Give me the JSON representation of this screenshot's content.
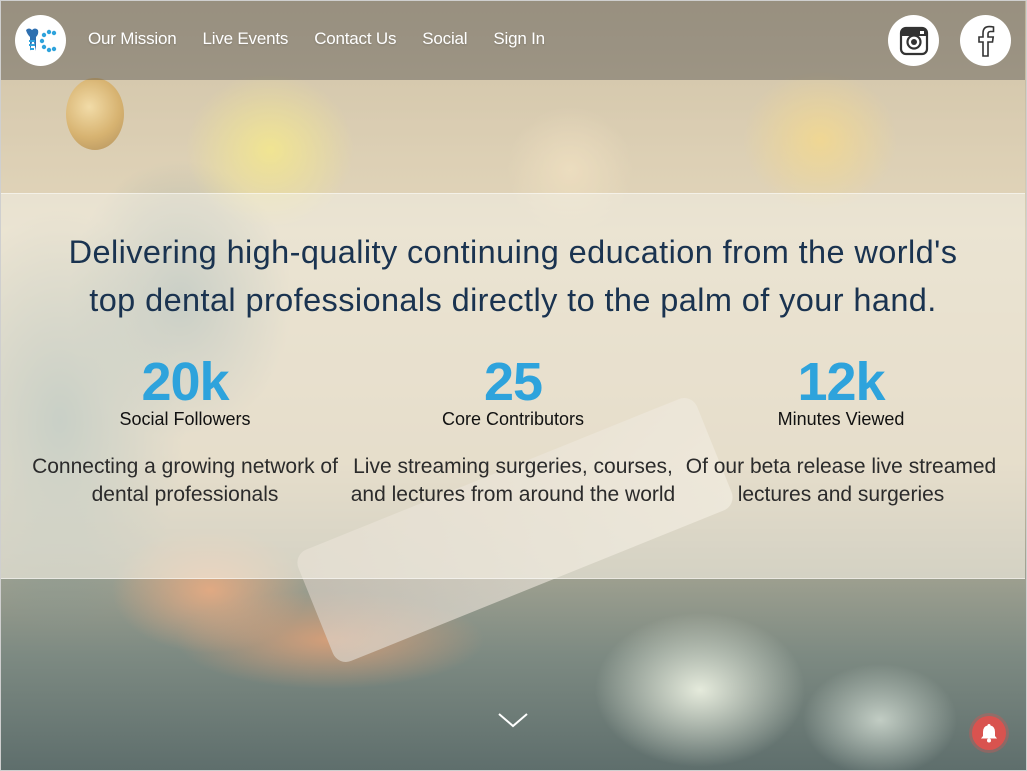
{
  "nav": {
    "logo_icon": "tooth-implant-logo-icon",
    "links": [
      {
        "label": "Our Mission"
      },
      {
        "label": "Live Events"
      },
      {
        "label": "Contact Us"
      },
      {
        "label": "Social"
      },
      {
        "label": "Sign In"
      }
    ],
    "social": {
      "instagram_icon": "instagram-icon",
      "facebook_icon": "facebook-icon"
    }
  },
  "hero": {
    "headline_line1": "Delivering high-quality continuing education from the world's",
    "headline_line2": "top dental professionals directly to the palm of your hand.",
    "stats": [
      {
        "value": "20k",
        "label": "Social Followers",
        "description": "Connecting a growing network of dental professionals"
      },
      {
        "value": "25",
        "label": "Core Contributors",
        "description": "Live streaming surgeries, courses, and lectures from around the world"
      },
      {
        "value": "12k",
        "label": "Minutes Viewed",
        "description": "Of our beta release live streamed lectures and surgeries"
      }
    ],
    "scroll_icon": "chevron-down-icon",
    "notification_icon": "bell-icon"
  },
  "colors": {
    "accent": "#2ea3dc",
    "headline": "#1a3350",
    "notification": "#d9534f"
  }
}
